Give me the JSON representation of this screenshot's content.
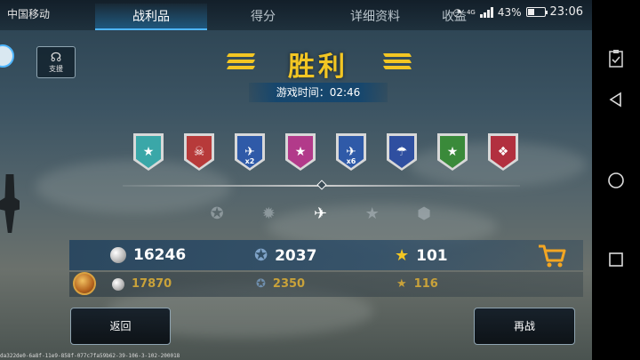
{
  "status_bar": {
    "carrier": "中国移动",
    "network": "4G",
    "battery": "43%",
    "battery_level": 0.43,
    "time": "23:06"
  },
  "tabs": [
    {
      "label": "战利品",
      "active": true
    },
    {
      "label": "得分",
      "active": false
    },
    {
      "label": "详细资料",
      "active": false
    },
    {
      "label": "收益",
      "active": false
    }
  ],
  "support_button": {
    "label": "支援"
  },
  "result": {
    "title": "胜利",
    "game_time_label": "游戏时间：02:46"
  },
  "medals": [
    {
      "name": "teal-stars-medal",
      "color": "#3aa7a8",
      "multiplier": ""
    },
    {
      "name": "red-skull-medal",
      "color": "#b73a3a",
      "multiplier": ""
    },
    {
      "name": "plane-medal",
      "color": "#2f5aa8",
      "multiplier": "x2"
    },
    {
      "name": "magenta-star-medal",
      "color": "#b23a8a",
      "multiplier": ""
    },
    {
      "name": "plane-medal",
      "color": "#2f5aa8",
      "multiplier": "x6"
    },
    {
      "name": "parachute-medal",
      "color": "#2f4fa0",
      "multiplier": ""
    },
    {
      "name": "green-red-star-medal",
      "color": "#3a8a3a",
      "multiplier": ""
    },
    {
      "name": "crimson-medal",
      "color": "#b2303f",
      "multiplier": ""
    }
  ],
  "progress": {
    "value": 0.5
  },
  "ranks": [
    {
      "name": "wings-rank-icon",
      "glyph": "✪",
      "active": false
    },
    {
      "name": "star-wings-rank-icon",
      "glyph": "✹",
      "active": false
    },
    {
      "name": "plane-rank-icon",
      "glyph": "✈",
      "active": true
    },
    {
      "name": "star-laurel-rank-icon",
      "glyph": "★",
      "active": false
    },
    {
      "name": "hex-rank-icon",
      "glyph": "⬢",
      "active": false
    }
  ],
  "rewards": {
    "credits": "16246",
    "experience": "2037",
    "stars": "101"
  },
  "premium_rewards": {
    "credits": "17870",
    "experience": "2350",
    "stars": "116"
  },
  "buttons": {
    "back": "返回",
    "retry": "再战"
  },
  "footer_id": "da322de0-6a8f-11e9-858f-077c7fa59b62-39-106-3-102-200018",
  "colors": {
    "gold": "#f3c623",
    "accent_blue": "#4fb6ff",
    "premium_gold": "#c9a23a"
  }
}
